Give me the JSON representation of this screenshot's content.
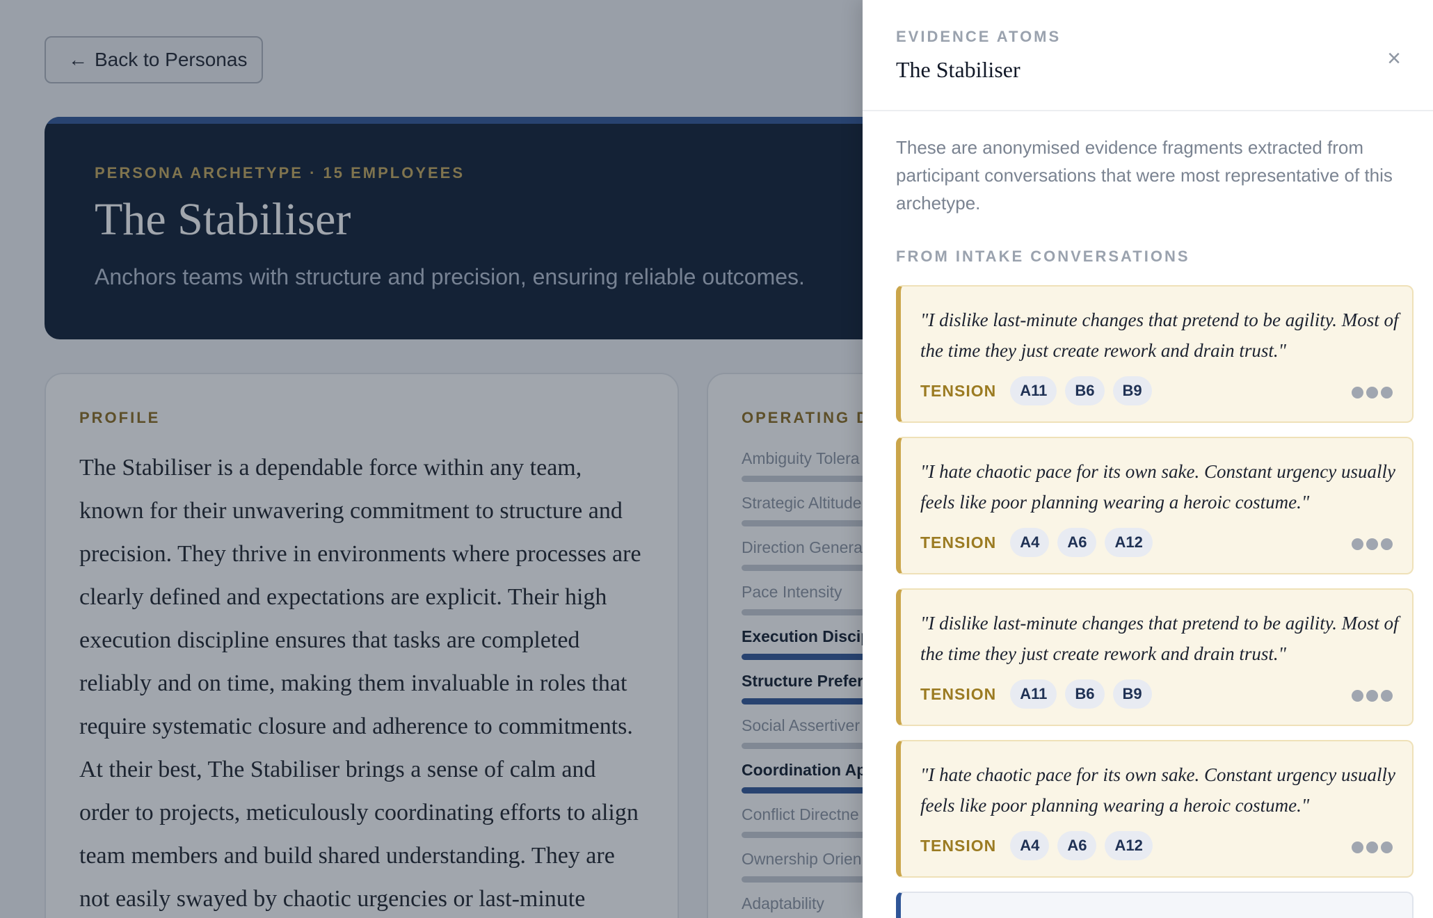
{
  "page": {
    "back_button": "Back to Personas",
    "hero": {
      "eyebrow": "PERSONA ARCHETYPE · 15 EMPLOYEES",
      "title": "The Stabiliser",
      "subtitle": "Anchors teams with structure and precision, ensuring reliable outcomes."
    },
    "profile": {
      "label": "PROFILE",
      "text": "The Stabiliser is a dependable force within any team, known for their unwavering commitment to structure and precision. They thrive in environments where processes are clearly defined and expectations are explicit. Their high execution discipline ensures that tasks are completed reliably and on time, making them invaluable in roles that require systematic closure and adherence to commitments. At their best, The Stabiliser brings a sense of calm and order to projects, meticulously coordinating efforts to align team members and build shared understanding. They are not easily swayed by chaotic urgencies or last-minute changes, preferring to operate"
    },
    "operating": {
      "label": "OPERATING DI",
      "items": [
        {
          "label": "Ambiguity Tolera",
          "emphasis": false
        },
        {
          "label": "Strategic Altitude",
          "emphasis": false
        },
        {
          "label": "Direction Genera",
          "emphasis": false
        },
        {
          "label": "Pace Intensity",
          "emphasis": false
        },
        {
          "label": "Execution Discip",
          "emphasis": true
        },
        {
          "label": "Structure Prefere",
          "emphasis": true
        },
        {
          "label": "Social Assertiver",
          "emphasis": false
        },
        {
          "label": "Coordination Ap",
          "emphasis": true
        },
        {
          "label": "Conflict Directne",
          "emphasis": false
        },
        {
          "label": "Ownership Orien",
          "emphasis": false
        },
        {
          "label": "Adaptability",
          "emphasis": false
        }
      ]
    }
  },
  "drawer": {
    "eyebrow": "EVIDENCE ATOMS",
    "title": "The Stabiliser",
    "close_icon": "close-icon",
    "intro": "These are anonymised evidence fragments extracted from participant conversations that were most representative of this archetype.",
    "section_label": "FROM INTAKE CONVERSATIONS",
    "atoms": [
      {
        "quote": "\"I dislike last-minute changes that pretend to be agility. Most of the time they just create rework and drain trust.\"",
        "tag": "TENSION",
        "codes": [
          "A11",
          "B6",
          "B9"
        ]
      },
      {
        "quote": "\"I hate chaotic pace for its own sake. Constant urgency usually feels like poor planning wearing a heroic costume.\"",
        "tag": "TENSION",
        "codes": [
          "A4",
          "A6",
          "A12"
        ]
      },
      {
        "quote": "\"I dislike last-minute changes that pretend to be agility. Most of the time they just create rework and drain trust.\"",
        "tag": "TENSION",
        "codes": [
          "A11",
          "B6",
          "B9"
        ]
      },
      {
        "quote": "\"I hate chaotic pace for its own sake. Constant urgency usually feels like poor planning wearing a heroic costume.\"",
        "tag": "TENSION",
        "codes": [
          "A4",
          "A6",
          "A12"
        ]
      }
    ]
  }
}
